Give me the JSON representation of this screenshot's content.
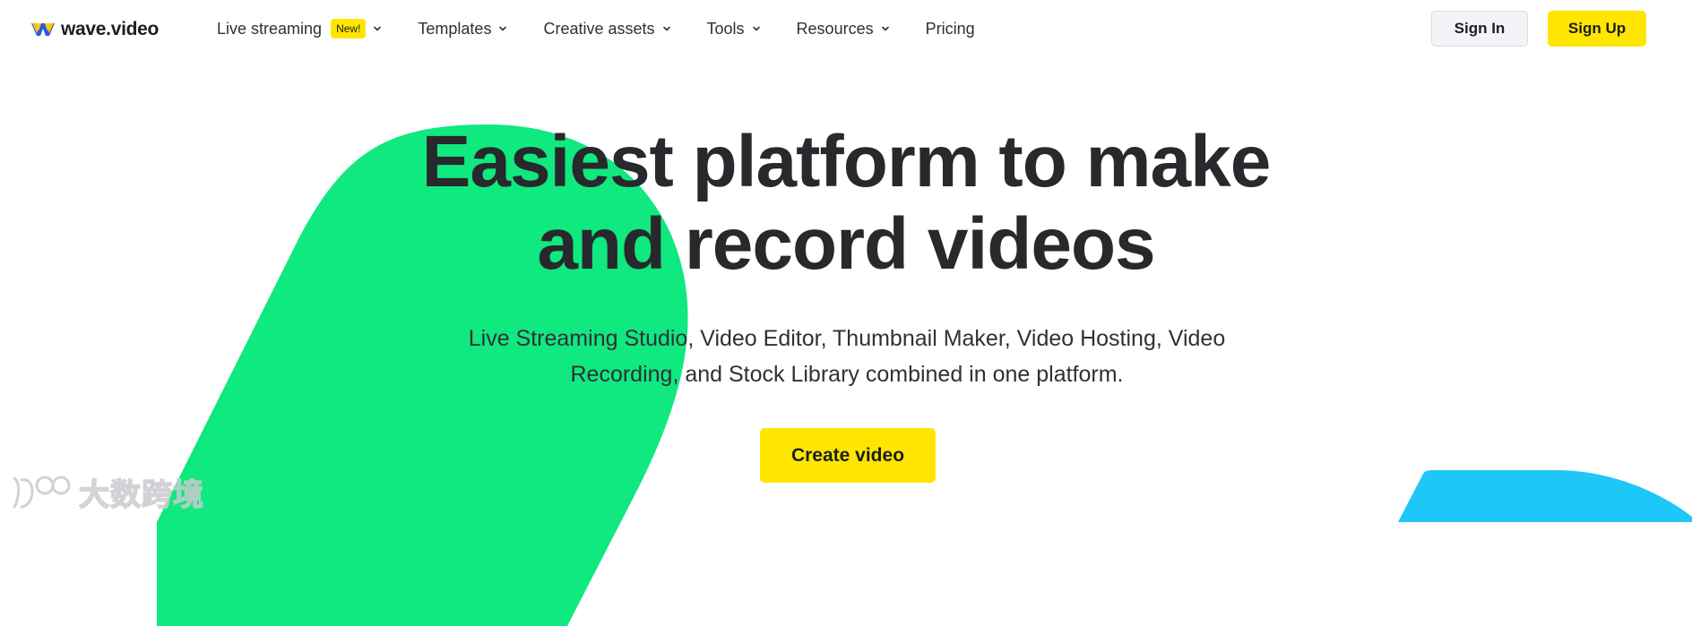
{
  "brand": {
    "name": "wave.video",
    "logo_colors": [
      "#ffc800",
      "#2a5bd7"
    ]
  },
  "nav": {
    "items": [
      {
        "label": "Live streaming",
        "badge": "New!",
        "has_dropdown": true
      },
      {
        "label": "Templates",
        "has_dropdown": true
      },
      {
        "label": "Creative assets",
        "has_dropdown": true
      },
      {
        "label": "Tools",
        "has_dropdown": true
      },
      {
        "label": "Resources",
        "has_dropdown": true
      },
      {
        "label": "Pricing",
        "has_dropdown": false
      }
    ],
    "icons": {
      "dropdown": "chevron-down-icon"
    }
  },
  "auth": {
    "sign_in_label": "Sign In",
    "sign_up_label": "Sign Up"
  },
  "hero": {
    "title_line1": "Easiest platform to make",
    "title_line2": "and record videos",
    "subtitle_line1": "Live Streaming Studio, Video Editor, Thumbnail Maker, Video Hosting, Video",
    "subtitle_line2": "Recording, and Stock Library combined in one platform.",
    "cta_label": "Create video"
  },
  "watermark": {
    "text": "大数跨境"
  },
  "colors": {
    "accent_yellow": "#ffe600",
    "shape_green": "#10e880",
    "shape_blue": "#1ec7f8",
    "text_dark": "#27292c",
    "signin_bg": "#f3f4f7"
  }
}
